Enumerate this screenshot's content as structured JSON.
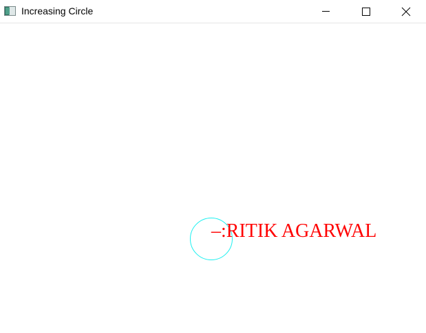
{
  "window": {
    "title": "Increasing Circle",
    "icon": "app-window-icon",
    "controls": {
      "minimize": "minimize-icon",
      "maximize": "maximize-icon",
      "close": "close-icon"
    }
  },
  "canvas": {
    "text": "–:RITIK AGARWAL",
    "text_color": "#ff0000",
    "circle_color": "#19f0f0",
    "background": "#ffffff"
  }
}
